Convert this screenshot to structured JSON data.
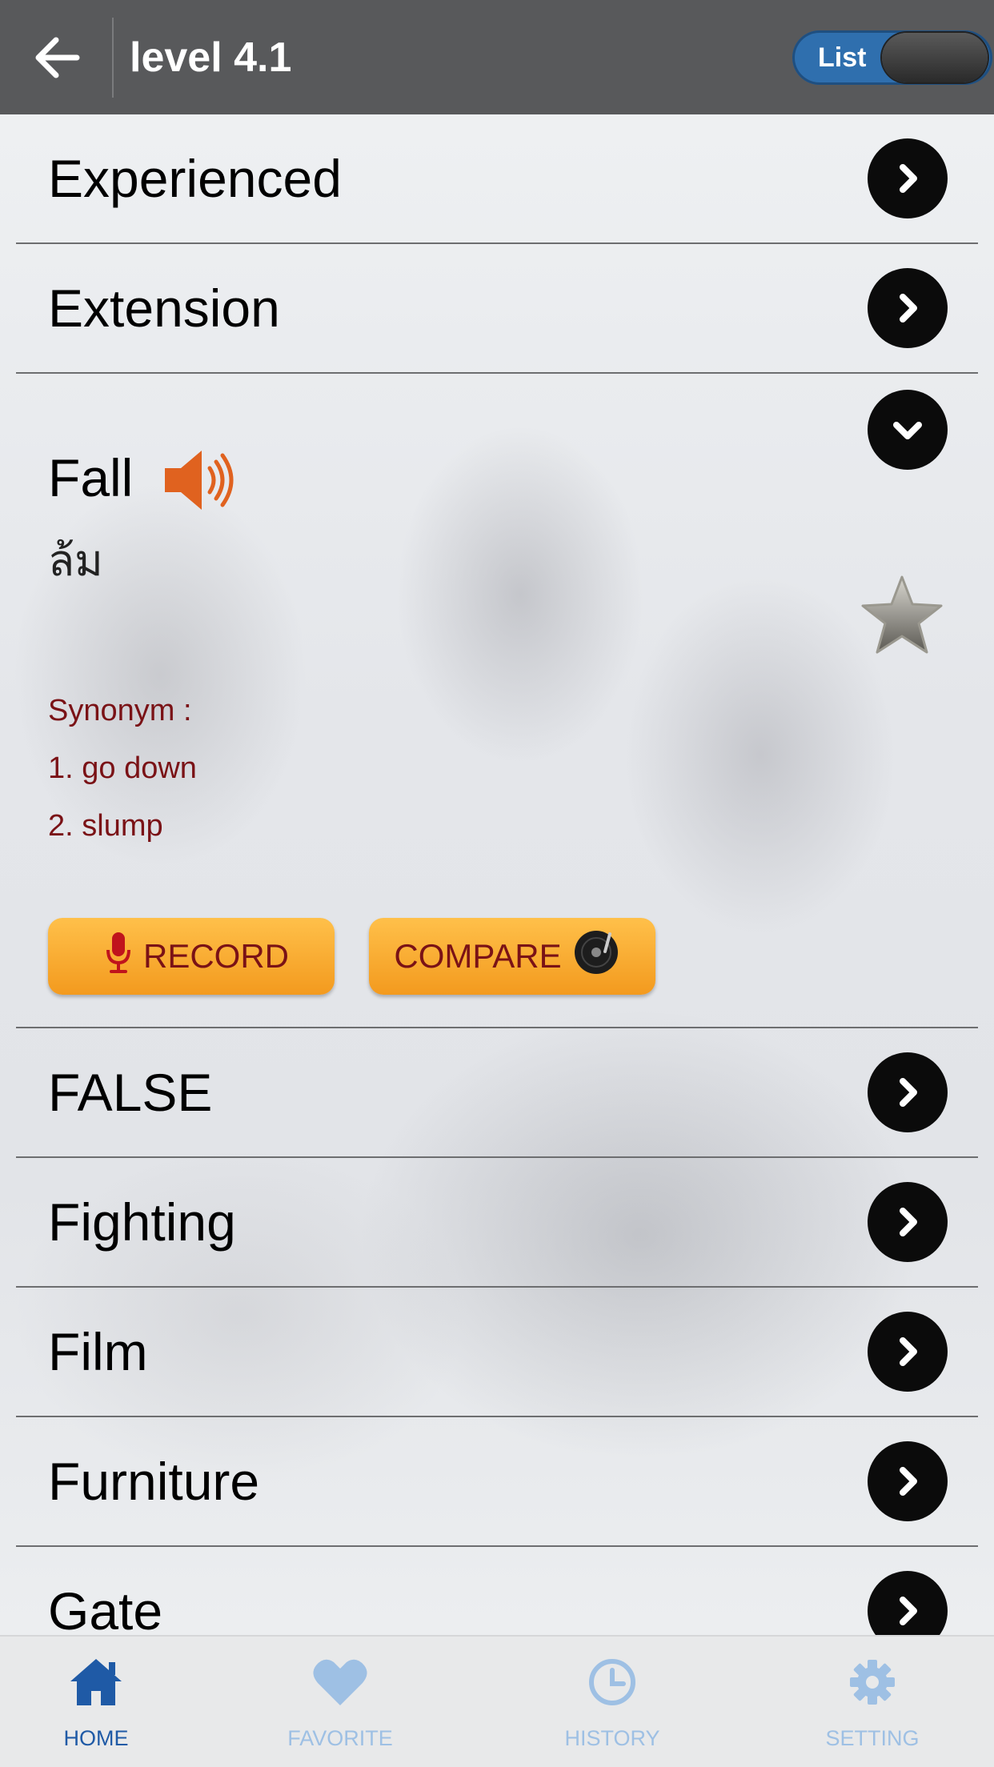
{
  "header": {
    "title": "level 4.1",
    "toggle_label": "List"
  },
  "words": {
    "before": [
      {
        "label": "Experienced"
      },
      {
        "label": "Extension"
      }
    ],
    "expanded": {
      "label": "Fall",
      "translation": "ล้ม",
      "synonym_title": "Synonym  :",
      "synonyms": [
        "1. go down",
        "2. slump"
      ],
      "record_label": "RECORD",
      "compare_label": "COMPARE"
    },
    "after": [
      {
        "label": "FALSE"
      },
      {
        "label": "Fighting"
      },
      {
        "label": "Film"
      },
      {
        "label": "Furniture"
      },
      {
        "label": "Gate"
      }
    ]
  },
  "tabs": [
    {
      "label": "HOME",
      "icon": "home-icon",
      "active": true
    },
    {
      "label": "FAVORITE",
      "icon": "heart-icon",
      "active": false
    },
    {
      "label": "HISTORY",
      "icon": "clock-icon",
      "active": false
    },
    {
      "label": "SETTING",
      "icon": "gear-icon",
      "active": false
    }
  ],
  "colors": {
    "header_bg": "#58595b",
    "toggle_blue": "#2f6fae",
    "synonym_text": "#7a1216",
    "button_orange": "#f39a1e",
    "speaker_orange": "#e0621f",
    "tab_active": "#1f5aa6",
    "tab_inactive": "#9ec0e4"
  }
}
